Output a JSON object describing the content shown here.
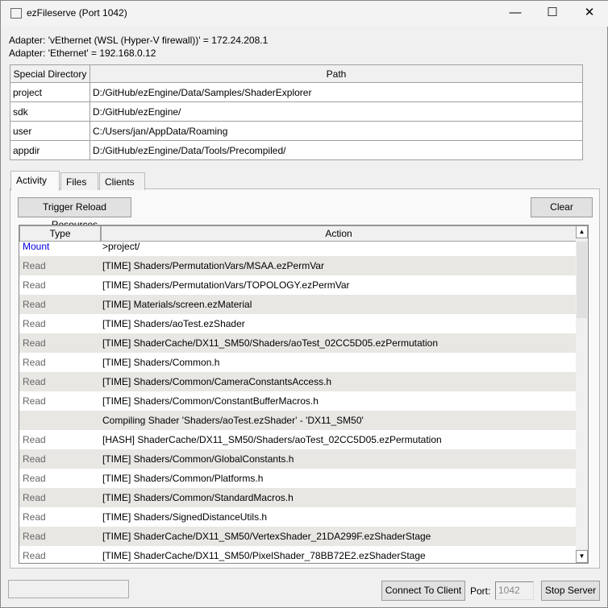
{
  "window": {
    "title": "ezFileserve (Port 1042)",
    "minimize": "—",
    "maximize": "☐",
    "close": "✕"
  },
  "adapters": [
    "Adapter: 'vEthernet (WSL (Hyper-V firewall))' = 172.24.208.1",
    "Adapter: 'Ethernet' = 192.168.0.12"
  ],
  "directories": {
    "headers": [
      "Special Directory",
      "Path"
    ],
    "rows": [
      [
        "project",
        "D:/GitHub/ezEngine/Data/Samples/ShaderExplorer"
      ],
      [
        "sdk",
        "D:/GitHub/ezEngine/"
      ],
      [
        "user",
        "C:/Users/jan/AppData/Roaming"
      ],
      [
        "appdir",
        "D:/GitHub/ezEngine/Data/Tools/Precompiled/"
      ]
    ]
  },
  "tabs": [
    "Activity",
    "Files",
    "Clients"
  ],
  "activity": {
    "trigger_reload": "Trigger Reload Resources",
    "clear": "Clear",
    "headers": [
      "Type",
      "Action"
    ],
    "rows": [
      [
        "Mount",
        ">project/"
      ],
      [
        "Read",
        "[TIME] Shaders/PermutationVars/MSAA.ezPermVar"
      ],
      [
        "Read",
        "[TIME] Shaders/PermutationVars/TOPOLOGY.ezPermVar"
      ],
      [
        "Read",
        "[TIME] Materials/screen.ezMaterial"
      ],
      [
        "Read",
        "[TIME] Shaders/aoTest.ezShader"
      ],
      [
        "Read",
        "[TIME] ShaderCache/DX11_SM50/Shaders/aoTest_02CC5D05.ezPermutation"
      ],
      [
        "Read",
        "[TIME] Shaders/Common.h"
      ],
      [
        "Read",
        "[TIME] Shaders/Common/CameraConstantsAccess.h"
      ],
      [
        "Read",
        "[TIME] Shaders/Common/ConstantBufferMacros.h"
      ],
      [
        "",
        "Compiling Shader 'Shaders/aoTest.ezShader' - 'DX11_SM50'"
      ],
      [
        "Read",
        "[HASH] ShaderCache/DX11_SM50/Shaders/aoTest_02CC5D05.ezPermutation"
      ],
      [
        "Read",
        "[TIME] Shaders/Common/GlobalConstants.h"
      ],
      [
        "Read",
        "[TIME] Shaders/Common/Platforms.h"
      ],
      [
        "Read",
        "[TIME] Shaders/Common/StandardMacros.h"
      ],
      [
        "Read",
        "[TIME] Shaders/SignedDistanceUtils.h"
      ],
      [
        "Read",
        "[TIME] ShaderCache/DX11_SM50/VertexShader_21DA299F.ezShaderStage"
      ],
      [
        "Read",
        "[TIME] ShaderCache/DX11_SM50/PixelShader_78BB72E2.ezShaderStage"
      ]
    ]
  },
  "footer": {
    "connect": "Connect To Client",
    "port_label": "Port:",
    "port_value": "1042",
    "stop": "Stop Server"
  }
}
